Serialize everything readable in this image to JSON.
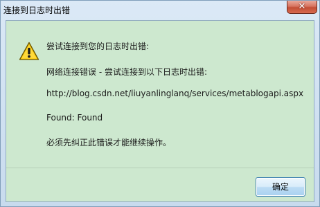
{
  "window": {
    "title": "连接到日志时出错",
    "close_symbol": "✕"
  },
  "dialog": {
    "icon": "warning-icon",
    "line1": "尝试连接到您的日志时出错:",
    "line2": "网络连接错误 - 尝试连接到以下日志时出错:",
    "line3": "http://blog.csdn.net/liuyanlinglanq/services/metablogapi.aspx",
    "line4": "Found: Found",
    "line5": "必须先纠正此错误才能继续操作。"
  },
  "buttons": {
    "ok_label": "确定"
  },
  "colors": {
    "client_background": "#cde8cf",
    "warning_yellow": "#f5c400"
  }
}
